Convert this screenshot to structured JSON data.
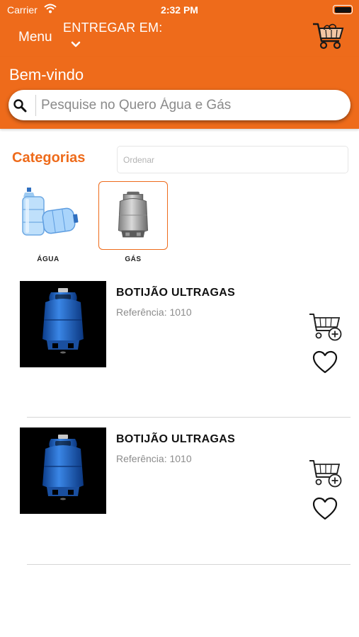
{
  "status_bar": {
    "carrier": "Carrier",
    "time": "2:32 PM"
  },
  "nav": {
    "menu_label": "Menu",
    "deliver_label": "ENTREGAR EM:"
  },
  "header": {
    "welcome": "Bem-vindo"
  },
  "search": {
    "placeholder": "Pesquise no Quero Água e Gás",
    "value": ""
  },
  "categories": {
    "title": "Categorias",
    "sort_placeholder": "Ordenar",
    "items": [
      {
        "label": "ÁGUA",
        "icon": "water-jug-icon",
        "selected": false
      },
      {
        "label": "GÁS",
        "icon": "gas-cylinder-icon",
        "selected": true
      }
    ]
  },
  "products": [
    {
      "name": "BOTIJÃO ULTRAGAS",
      "reference": "Referência: 1010",
      "image": "blue-gas-cylinder-image"
    },
    {
      "name": "BOTIJÃO ULTRAGAS",
      "reference": "Referência: 1010",
      "image": "blue-gas-cylinder-image"
    }
  ],
  "colors": {
    "brand": "#EE6B1B",
    "text": "#111111",
    "muted": "#8c8c8c"
  }
}
